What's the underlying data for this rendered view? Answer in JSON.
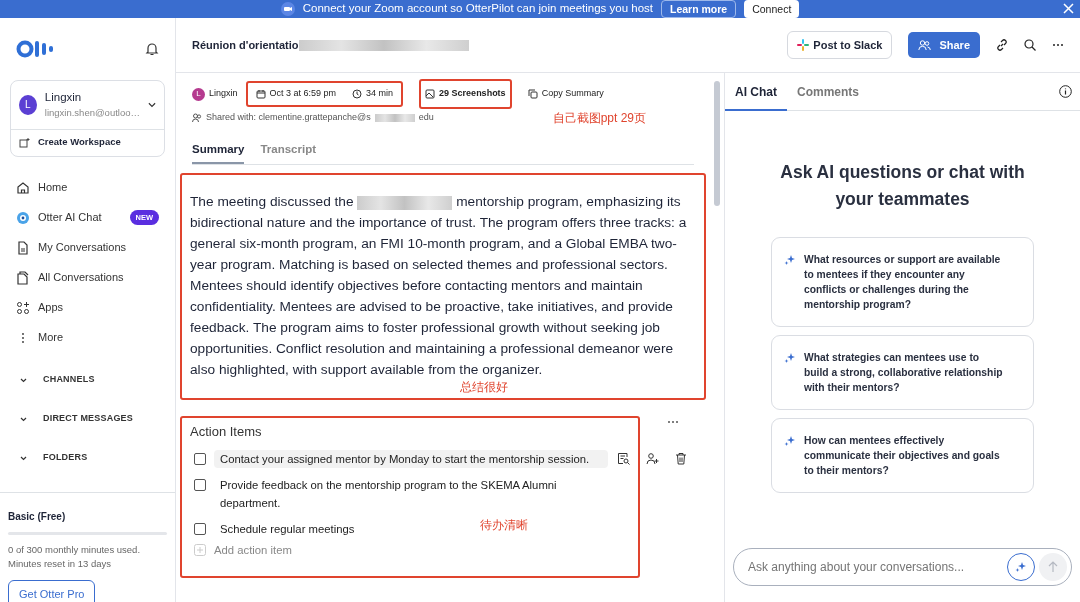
{
  "banner": {
    "text": "Connect your Zoom account so OtterPilot can join meetings you host",
    "learn_more": "Learn more",
    "connect": "Connect"
  },
  "sidebar": {
    "user": {
      "initial": "L",
      "name": "Lingxin",
      "email": "lingxin.shen@outloo…"
    },
    "create_workspace": "Create Workspace",
    "nav": [
      {
        "label": "Home",
        "kind": "home"
      },
      {
        "label": "Otter AI Chat",
        "kind": "chat",
        "badge": "NEW"
      },
      {
        "label": "My Conversations",
        "kind": "doc"
      },
      {
        "label": "All Conversations",
        "kind": "docs"
      },
      {
        "label": "Apps",
        "kind": "apps"
      },
      {
        "label": "More",
        "kind": "more"
      }
    ],
    "sections": [
      {
        "label": "CHANNELS",
        "expanded": false
      },
      {
        "label": "DIRECT MESSAGES",
        "expanded": false
      },
      {
        "label": "FOLDERS",
        "expanded": false
      }
    ],
    "plan": {
      "name": "Basic (Free)",
      "level": 0,
      "usage": "0 of 300 monthly minutes used.",
      "reset": "Minutes reset in 13 days",
      "upgrade": "Get Otter Pro"
    }
  },
  "header": {
    "title": "Réunion d'orientatio",
    "post_to_slack": "Post to Slack",
    "share": "Share"
  },
  "meta": {
    "owner_initial": "L",
    "owner": "Lingxin",
    "date": "Oct 3 at 6:59 pm",
    "duration": "34 min",
    "screenshots": "29 Screenshots",
    "copy_summary": "Copy Summary",
    "shared_with": "Shared with: clementine.grattepanche@s",
    "shared_with_end": "edu"
  },
  "tabs": [
    {
      "label": "Summary",
      "selected": true
    },
    {
      "label": "Transcript",
      "selected": false
    }
  ],
  "summary": {
    "before": "The meeting discussed the",
    "after": "mentorship program, emphasizing its bidirectional nature and the importance of trust. The program offers three tracks: a general six-month program, an FMI 10-month program, and a Global EMBA two-year program. Matching is based on selected themes and professional sectors. Mentees should identify objectives before contacting mentors and maintain confidentiality. Mentees are advised to be proactive, take initiatives, and provide feedback. The program aims to foster professional growth without seeking job opportunities. Conflict resolution and maintaining a professional demeanor were also highlighted, with support available from the organizer."
  },
  "action_items": {
    "title": "Action Items",
    "items": [
      {
        "text": "Contact your assigned mentor by Monday to start the mentorship session.",
        "checked": false,
        "hovered": true
      },
      {
        "text": "Provide feedback on the mentorship program to the SKEMA Alumni department.",
        "checked": false,
        "hovered": false
      },
      {
        "text": "Schedule regular meetings",
        "checked": false,
        "hovered": false
      }
    ],
    "add": "Add action item"
  },
  "annotations": [
    {
      "text": "自己截图ppt 29页"
    },
    {
      "text": "总结很好"
    },
    {
      "text": "待办清晰"
    }
  ],
  "chat": {
    "tabs": [
      {
        "label": "AI Chat",
        "selected": true
      },
      {
        "label": "Comments",
        "selected": false
      }
    ],
    "heading": "Ask AI questions or chat with your teammates",
    "suggestions": [
      {
        "text": "What resources or support are available to mentees if they encounter any conflicts or challenges during the mentorship program?"
      },
      {
        "text": "What strategies can mentees use to build a strong, collaborative relationship with their mentors?"
      },
      {
        "text": "How can mentees effectively communicate their objectives and goals to their mentors?"
      }
    ],
    "input": {
      "placeholder": "Ask anything about your conversations..."
    }
  }
}
